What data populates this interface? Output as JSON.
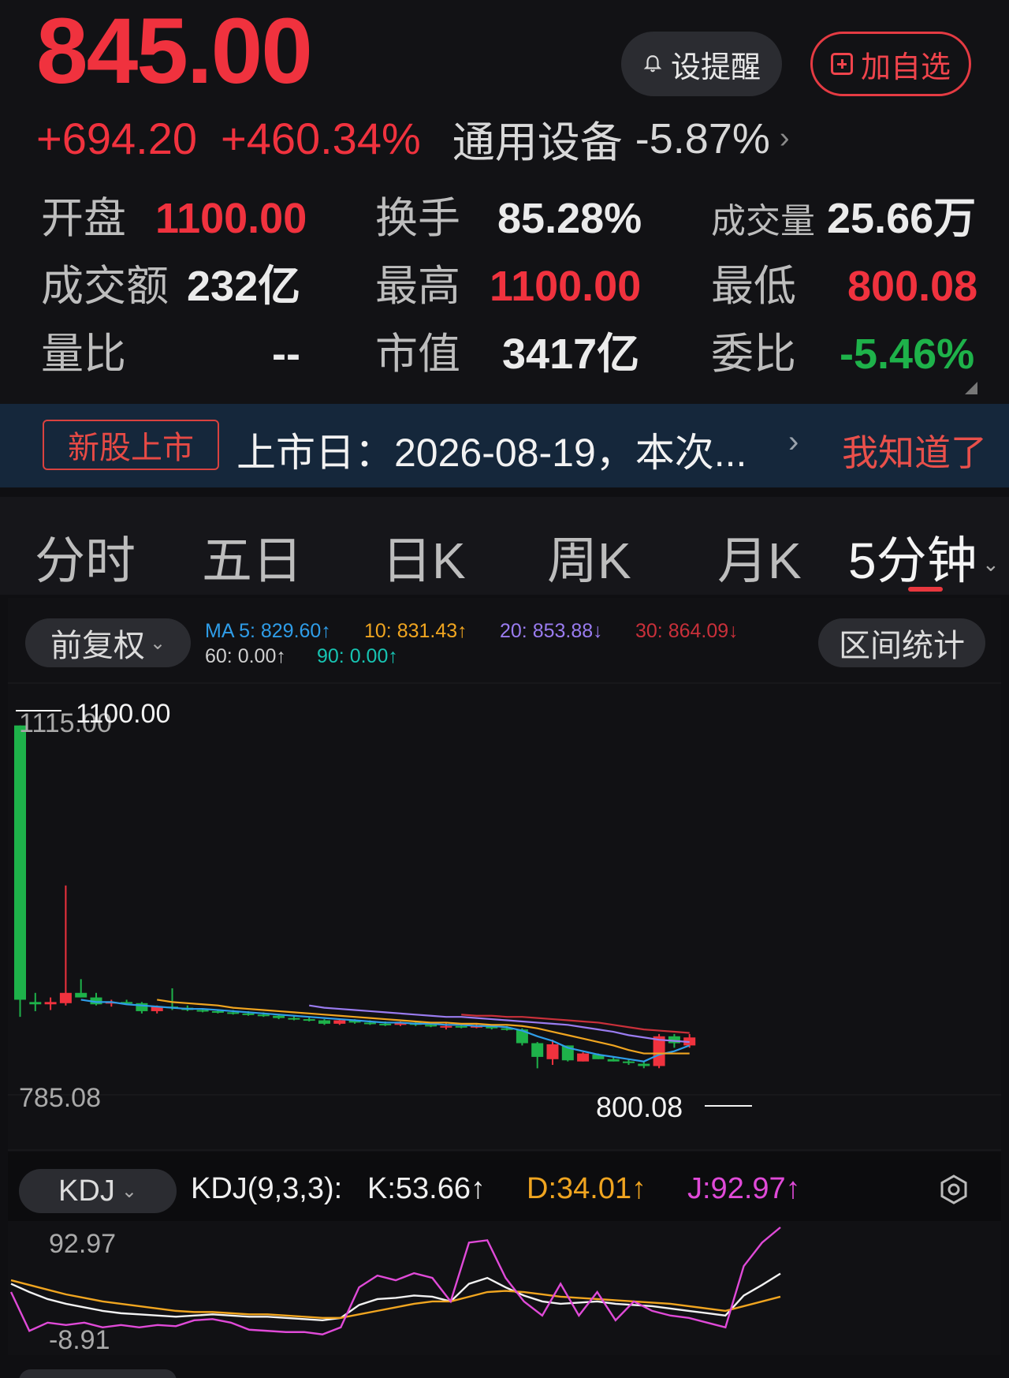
{
  "quote": {
    "price": "845.00",
    "change": "+694.20",
    "change_pct": "+460.34%",
    "industry_name": "通用设备",
    "industry_pct": "-5.87%"
  },
  "actions": {
    "remind_label": "设提醒",
    "add_label": "加自选"
  },
  "stats": {
    "open_label": "开盘",
    "open_value": "1100.00",
    "turnover_rate_label": "换手",
    "turnover_rate_value": "85.28%",
    "volume_label": "成交量",
    "volume_value": "25.66万",
    "amount_label": "成交额",
    "amount_value": "232亿",
    "high_label": "最高",
    "high_value": "1100.00",
    "low_label": "最低",
    "low_value": "800.08",
    "vol_ratio_label": "量比",
    "vol_ratio_value": "--",
    "mcap_label": "市值",
    "mcap_value": "3417亿",
    "bid_ratio_label": "委比",
    "bid_ratio_value": "-5.46%"
  },
  "banner": {
    "badge": "新股上市",
    "text": "上市日：2026-08-19，本次...",
    "dismiss": "我知道了"
  },
  "tabs": [
    "分时",
    "五日",
    "日K",
    "周K",
    "月K",
    "5分钟"
  ],
  "chart_toolbar": {
    "adjust_label": "前复权",
    "ma5": "MA 5: 829.60↑",
    "ma10": "10: 831.43↑",
    "ma20": "20: 853.88↓",
    "ma30": "30: 864.09↓",
    "ma60": "60: 0.00↑",
    "ma90": "90: 0.00↑",
    "range_stats_label": "区间统计"
  },
  "kline_labels": {
    "y_max": "1115.00",
    "y_min": "785.08",
    "high_mark": "1100.00",
    "low_mark": "800.08"
  },
  "kdj": {
    "selector": "KDJ",
    "params": "KDJ(9,3,3):",
    "k": "K:53.66↑",
    "d": "D:34.01↑",
    "j": "J:92.97↑",
    "y_max": "92.97",
    "y_min": "-8.91"
  },
  "colors": {
    "up": "#f0323e",
    "down": "#1eb24a",
    "ma5": "#2f9de8",
    "ma10": "#f0a520",
    "ma20": "#9a7cf0",
    "ma30": "#c9303a",
    "ma60": "#cfcfcf",
    "ma90": "#17c4b2",
    "k": "#f2f2f2",
    "d": "#f0a520",
    "j": "#e04ad8"
  },
  "chart_data": [
    {
      "type": "candlestick",
      "ylim": [
        785.08,
        1115.0
      ],
      "candles": [
        {
          "o": 1100,
          "h": 1100,
          "l": 845,
          "c": 860
        },
        {
          "o": 858,
          "h": 866,
          "l": 850,
          "c": 856
        },
        {
          "o": 856,
          "h": 862,
          "l": 851,
          "c": 858
        },
        {
          "o": 857,
          "h": 960,
          "l": 855,
          "c": 866
        },
        {
          "o": 866,
          "h": 878,
          "l": 862,
          "c": 862
        },
        {
          "o": 862,
          "h": 866,
          "l": 855,
          "c": 856
        },
        {
          "o": 857,
          "h": 860,
          "l": 854,
          "c": 858
        },
        {
          "o": 858,
          "h": 860,
          "l": 856,
          "c": 857
        },
        {
          "o": 857,
          "h": 858,
          "l": 848,
          "c": 850
        },
        {
          "o": 850,
          "h": 855,
          "l": 848,
          "c": 854
        },
        {
          "o": 854,
          "h": 870,
          "l": 851,
          "c": 853
        },
        {
          "o": 853,
          "h": 855,
          "l": 850,
          "c": 851
        },
        {
          "o": 851,
          "h": 852,
          "l": 849,
          "c": 850
        },
        {
          "o": 850,
          "h": 851,
          "l": 848,
          "c": 849
        },
        {
          "o": 849,
          "h": 851,
          "l": 847,
          "c": 848
        },
        {
          "o": 848,
          "h": 850,
          "l": 846,
          "c": 847
        },
        {
          "o": 847,
          "h": 849,
          "l": 845,
          "c": 846
        },
        {
          "o": 846,
          "h": 847,
          "l": 843,
          "c": 844
        },
        {
          "o": 844,
          "h": 846,
          "l": 842,
          "c": 843
        },
        {
          "o": 843,
          "h": 845,
          "l": 841,
          "c": 842
        },
        {
          "o": 842,
          "h": 843,
          "l": 838,
          "c": 839
        },
        {
          "o": 839,
          "h": 843,
          "l": 838,
          "c": 842
        },
        {
          "o": 842,
          "h": 843,
          "l": 839,
          "c": 840
        },
        {
          "o": 840,
          "h": 842,
          "l": 838,
          "c": 839
        },
        {
          "o": 839,
          "h": 841,
          "l": 837,
          "c": 838
        },
        {
          "o": 838,
          "h": 841,
          "l": 837,
          "c": 840
        },
        {
          "o": 840,
          "h": 841,
          "l": 837,
          "c": 838
        },
        {
          "o": 838,
          "h": 840,
          "l": 836,
          "c": 837
        },
        {
          "o": 836,
          "h": 840,
          "l": 834,
          "c": 837
        },
        {
          "o": 837,
          "h": 839,
          "l": 835,
          "c": 836
        },
        {
          "o": 836,
          "h": 839,
          "l": 835,
          "c": 837
        },
        {
          "o": 837,
          "h": 838,
          "l": 834,
          "c": 835
        },
        {
          "o": 835,
          "h": 837,
          "l": 833,
          "c": 834
        },
        {
          "o": 834,
          "h": 835,
          "l": 820,
          "c": 822
        },
        {
          "o": 822,
          "h": 823,
          "l": 800,
          "c": 810
        },
        {
          "o": 808,
          "h": 825,
          "l": 803,
          "c": 821
        },
        {
          "o": 820,
          "h": 820,
          "l": 806,
          "c": 807
        },
        {
          "o": 806,
          "h": 814,
          "l": 806,
          "c": 813
        },
        {
          "o": 812,
          "h": 813,
          "l": 808,
          "c": 808
        },
        {
          "o": 808,
          "h": 810,
          "l": 806,
          "c": 806
        },
        {
          "o": 806,
          "h": 808,
          "l": 803,
          "c": 805
        },
        {
          "o": 804,
          "h": 806,
          "l": 800.08,
          "c": 802
        },
        {
          "o": 802,
          "h": 830,
          "l": 800.08,
          "c": 828
        },
        {
          "o": 828,
          "h": 830,
          "l": 818,
          "c": 822
        },
        {
          "o": 820,
          "h": 830,
          "l": 818,
          "c": 827
        }
      ],
      "ma5": [
        null,
        null,
        null,
        null,
        860,
        858,
        858,
        856,
        855,
        854,
        853,
        852,
        852,
        851,
        850,
        849,
        848,
        847,
        846,
        845,
        844,
        843,
        842,
        841,
        840,
        840,
        839,
        839,
        838,
        838,
        837,
        837,
        836,
        833,
        828,
        824,
        818,
        815,
        812,
        810,
        808,
        806,
        812,
        815,
        820
      ],
      "ma10": [
        null,
        null,
        null,
        null,
        null,
        null,
        null,
        null,
        null,
        860,
        858,
        857,
        856,
        855,
        853,
        852,
        851,
        850,
        849,
        848,
        847,
        846,
        845,
        844,
        843,
        842,
        841,
        840,
        840,
        839,
        839,
        838,
        838,
        837,
        835,
        832,
        829,
        826,
        823,
        820,
        816,
        813,
        813,
        813,
        813
      ],
      "ma20": [
        null,
        null,
        null,
        null,
        null,
        null,
        null,
        null,
        null,
        null,
        null,
        null,
        null,
        null,
        null,
        null,
        null,
        null,
        null,
        855,
        853,
        852,
        851,
        850,
        849,
        848,
        847,
        846,
        845,
        845,
        844,
        843,
        842,
        841,
        840,
        839,
        838,
        836,
        834,
        832,
        829,
        827,
        825,
        824,
        823
      ],
      "ma30": [
        null,
        null,
        null,
        null,
        null,
        null,
        null,
        null,
        null,
        null,
        null,
        null,
        null,
        null,
        null,
        null,
        null,
        null,
        null,
        null,
        null,
        null,
        null,
        null,
        null,
        null,
        null,
        null,
        null,
        847,
        846,
        846,
        845,
        845,
        844,
        843,
        842,
        841,
        840,
        838,
        836,
        834,
        833,
        832,
        831
      ]
    },
    {
      "type": "line",
      "ylim": [
        -8.91,
        92.97
      ],
      "series": [
        {
          "name": "K",
          "values": [
            45,
            38,
            32,
            28,
            25,
            22,
            20,
            19,
            18,
            17,
            18,
            19,
            18,
            17,
            17,
            16,
            15,
            14,
            16,
            27,
            32,
            33,
            35,
            34,
            30,
            45,
            50,
            42,
            35,
            30,
            28,
            29,
            30,
            28,
            27,
            26,
            24,
            22,
            20,
            18,
            35,
            44,
            53.66
          ]
        },
        {
          "name": "D",
          "values": [
            48,
            44,
            40,
            36,
            33,
            30,
            28,
            26,
            24,
            22,
            21,
            21,
            20,
            19,
            19,
            18,
            17,
            16,
            16,
            19,
            22,
            25,
            28,
            30,
            30,
            34,
            38,
            39,
            38,
            36,
            34,
            33,
            32,
            31,
            30,
            29,
            28,
            26,
            24,
            22,
            26,
            30,
            34.01
          ]
        },
        {
          "name": "J",
          "values": [
            38,
            5,
            12,
            10,
            12,
            8,
            10,
            8,
            10,
            9,
            14,
            15,
            12,
            6,
            5,
            4,
            4,
            2,
            8,
            42,
            52,
            48,
            54,
            50,
            30,
            80,
            82,
            50,
            30,
            18,
            45,
            18,
            38,
            14,
            30,
            22,
            18,
            16,
            12,
            8,
            60,
            80,
            92.97
          ]
        }
      ]
    }
  ]
}
